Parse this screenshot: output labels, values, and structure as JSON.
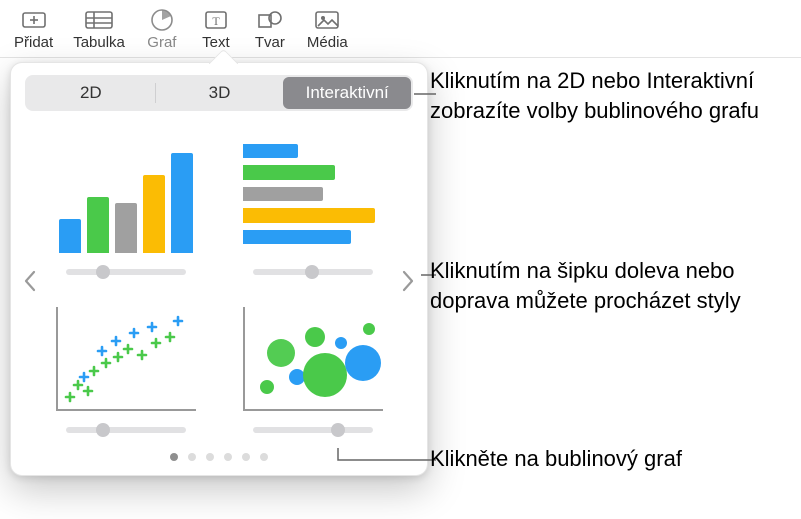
{
  "toolbar": {
    "items": [
      {
        "label": "Přidat"
      },
      {
        "label": "Tabulka"
      },
      {
        "label": "Graf"
      },
      {
        "label": "Text"
      },
      {
        "label": "Tvar"
      },
      {
        "label": "Média"
      }
    ]
  },
  "seg": {
    "items": [
      "2D",
      "3D",
      "Interaktivní"
    ],
    "selected": 2
  },
  "charts": {
    "colors": {
      "blue": "#2a9df4",
      "green": "#4ac94a",
      "gray": "#a0a0a0",
      "yellow": "#fbbc04"
    },
    "thumbnails": [
      {
        "name": "interactive-column-chart"
      },
      {
        "name": "interactive-bar-chart"
      },
      {
        "name": "interactive-scatter-chart"
      },
      {
        "name": "interactive-bubble-chart"
      }
    ]
  },
  "pager": {
    "count": 6,
    "active": 0
  },
  "callouts": {
    "top": "Kliknutím na 2D nebo Interaktivní zobrazíte volby bublinového grafu",
    "mid": "Kliknutím na šipku doleva nebo doprava můžete procházet styly",
    "bottom": "Klikněte na bublinový graf"
  }
}
